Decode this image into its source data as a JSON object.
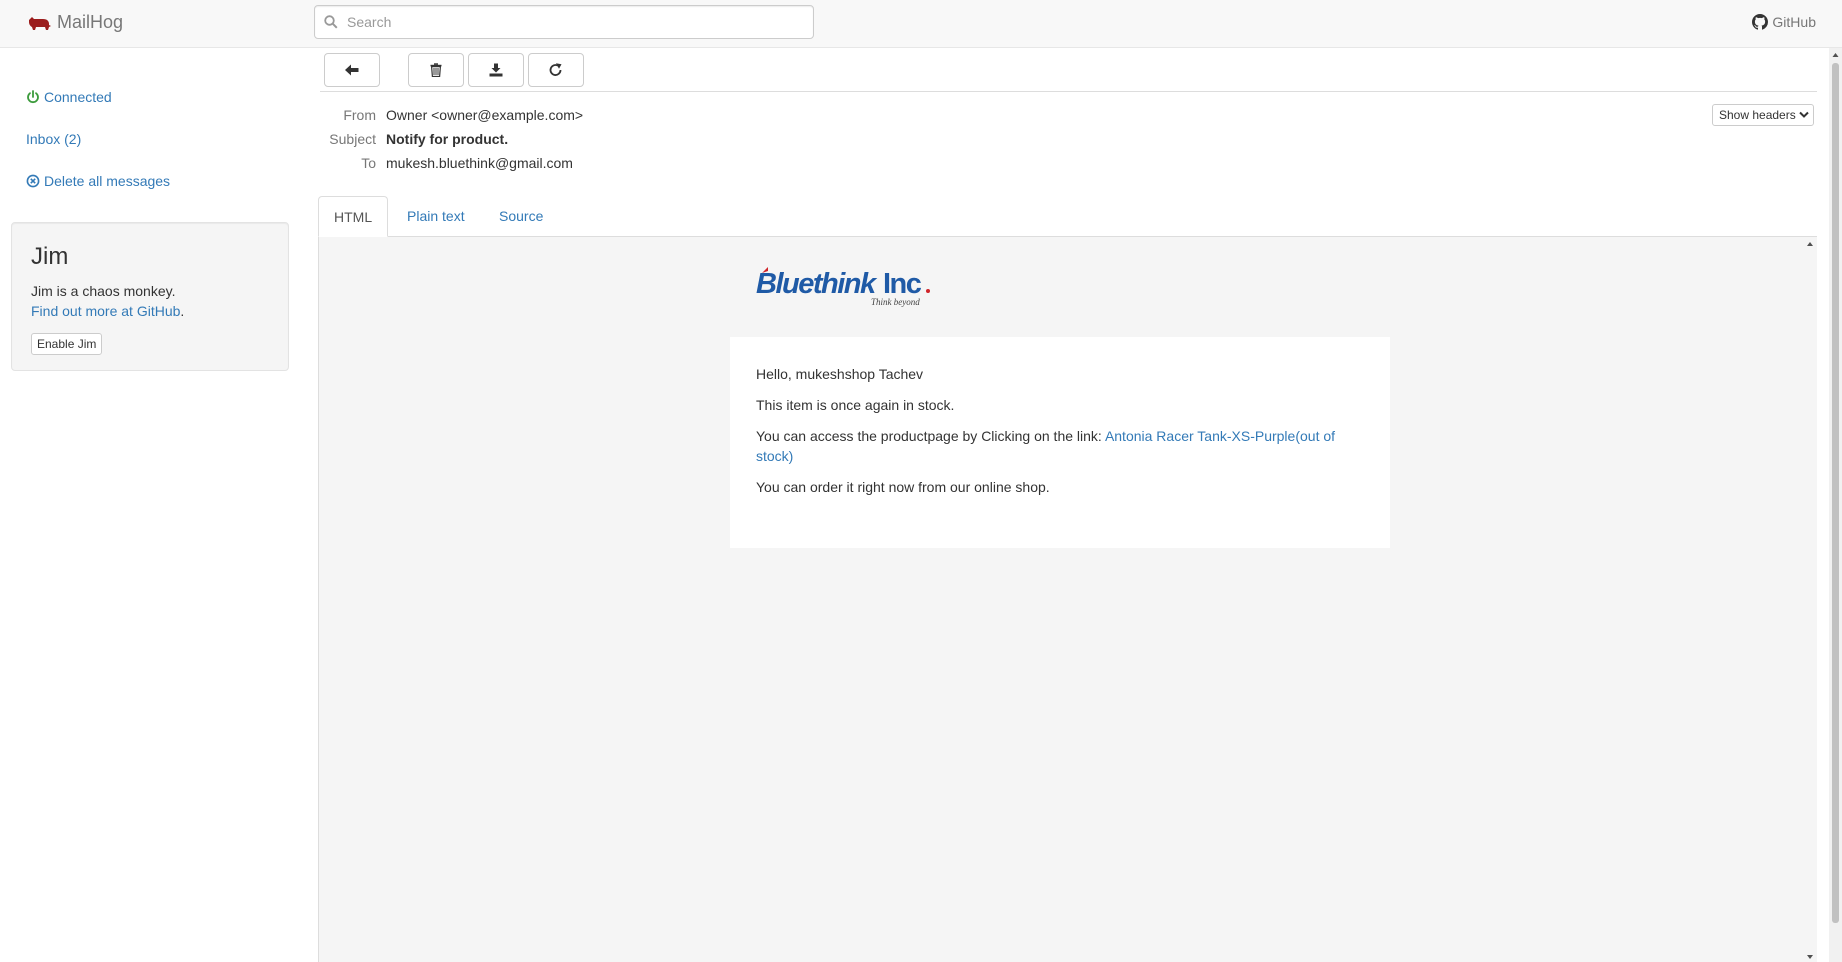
{
  "navbar": {
    "brand": "MailHog",
    "search_placeholder": "Search",
    "github_label": "GitHub"
  },
  "sidebar": {
    "connected_label": "Connected",
    "inbox_label": "Inbox (2)",
    "delete_all_label": "Delete all messages"
  },
  "jim": {
    "title": "Jim",
    "description": "Jim is a chaos monkey.",
    "link_text": "Find out more at GitHub",
    "link_suffix": ".",
    "button_label": "Enable Jim"
  },
  "message": {
    "from_label": "From",
    "from": "Owner <owner@example.com>",
    "subject_label": "Subject",
    "subject": "Notify for product.",
    "to_label": "To",
    "to": "mukesh.bluethink@gmail.com",
    "show_headers_label": "Show headers"
  },
  "tabs": [
    {
      "label": "HTML",
      "active": true
    },
    {
      "label": "Plain text",
      "active": false
    },
    {
      "label": "Source",
      "active": false
    }
  ],
  "email": {
    "logo_text": "BluethinkInc.",
    "logo_tagline": "Think beyond",
    "greeting": "Hello, mukeshshop Tachev",
    "line1": "This item is once again in stock.",
    "line2_prefix": "You can access the productpage by Clicking on the link: ",
    "line2_link": "Antonia Racer Tank-XS-Purple(out of stock)",
    "line3": "You can order it right now from our online shop."
  },
  "colors": {
    "link": "#337ab7",
    "connected_icon": "#3c9b3c",
    "brand_icon": "#9b1c1c",
    "logo_blue": "#1f5aa6",
    "logo_red": "#d0252a"
  }
}
